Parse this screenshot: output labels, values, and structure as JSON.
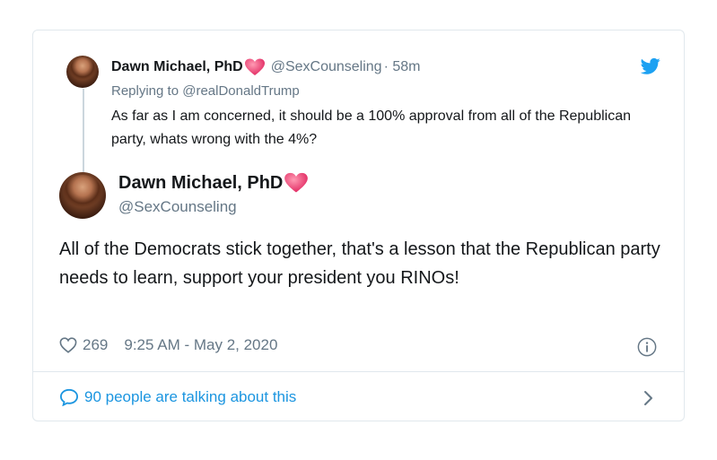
{
  "reply_tweet": {
    "author_name": "Dawn Michael, PhD",
    "handle": "@SexCounseling",
    "time": "· 58m",
    "replying_prefix": "Replying to",
    "replying_to": "@realDonaldTrump",
    "text": "As far as I am concerned, it should be a 100% approval from all of the Republican party, whats wrong with the 4%?"
  },
  "main_tweet": {
    "author_name": "Dawn Michael, PhD",
    "handle": "@SexCounseling",
    "text": "All of the Democrats stick together, that's a lesson that the Republican party needs to learn, support your president you RINOs!",
    "likes": "269",
    "timestamp": "9:25 AM - May 2, 2020"
  },
  "footer": {
    "talking_text": "90 people are talking about this"
  },
  "colors": {
    "link": "#1b95e0",
    "muted": "#657786",
    "heart": "#e0245e"
  },
  "icons": [
    "heart-emoji-icon",
    "twitter-bird-icon",
    "like-heart-icon",
    "info-icon",
    "speech-bubble-icon",
    "chevron-right-icon"
  ]
}
